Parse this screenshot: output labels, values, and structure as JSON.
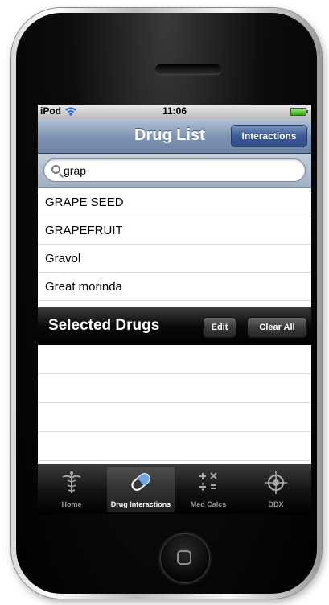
{
  "status_bar": {
    "carrier": "iPod",
    "time": "11:06"
  },
  "nav_bar": {
    "title": "Drug List",
    "button_label": "Interactions"
  },
  "search": {
    "value": "grap",
    "placeholder": ""
  },
  "results": [
    {
      "name": "GRAPE SEED"
    },
    {
      "name": "GRAPEFRUIT"
    },
    {
      "name": "Gravol"
    },
    {
      "name": "Great morinda"
    }
  ],
  "selected_section": {
    "title": "Selected Drugs",
    "edit_label": "Edit",
    "clear_label": "Clear All",
    "items": []
  },
  "tab_bar": {
    "selected": "Drug Interactions",
    "tabs": [
      {
        "label": "Home",
        "icon": "caduceus-icon"
      },
      {
        "label": "Drug Interactions",
        "icon": "capsule-icon"
      },
      {
        "label": "Med Calcs",
        "icon": "calculator-symbols-icon"
      },
      {
        "label": "DDX",
        "icon": "crosshair-icon"
      }
    ]
  },
  "colors": {
    "nav_bar": "#7d93b2",
    "nav_button": "#3a5b94",
    "battery": "#2fa50c",
    "tab_active": "#ffffff"
  }
}
